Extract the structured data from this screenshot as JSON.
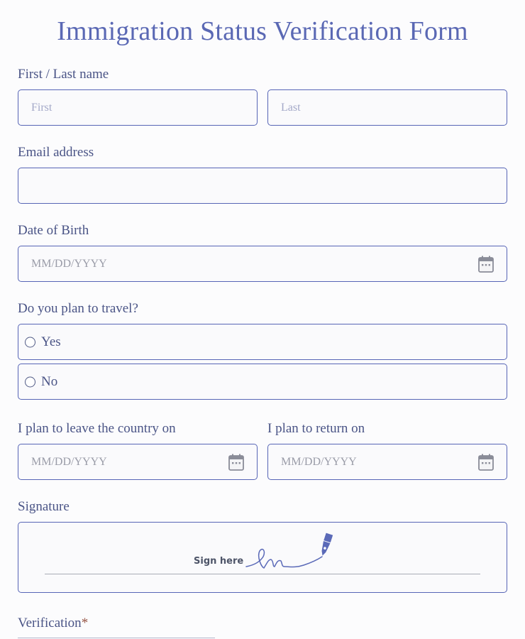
{
  "title": "Immigration Status Verification Form",
  "name_field": {
    "label": "First / Last name",
    "first_placeholder": "First",
    "last_placeholder": "Last"
  },
  "email_field": {
    "label": "Email address",
    "placeholder": ""
  },
  "dob_field": {
    "label": "Date of Birth",
    "placeholder": "MM/DD/YYYY",
    "icon": "calendar-icon"
  },
  "travel_question": {
    "label": "Do you plan to travel?",
    "options": [
      "Yes",
      "No"
    ]
  },
  "leave_field": {
    "label": "I plan to leave the country on",
    "placeholder": "MM/DD/YYYY",
    "icon": "calendar-icon"
  },
  "return_field": {
    "label": "I plan to return on",
    "placeholder": "MM/DD/YYYY",
    "icon": "calendar-icon"
  },
  "signature": {
    "label": "Signature",
    "prompt": "Sign here",
    "icon": "pen-nib-icon"
  },
  "verification": {
    "label": "Verification",
    "required_mark": "*"
  },
  "colors": {
    "accent": "#5765b6",
    "title": "#5a68b4",
    "label": "#4a5486",
    "placeholder": "#a3a8c8",
    "background": "#fcfcfd"
  }
}
